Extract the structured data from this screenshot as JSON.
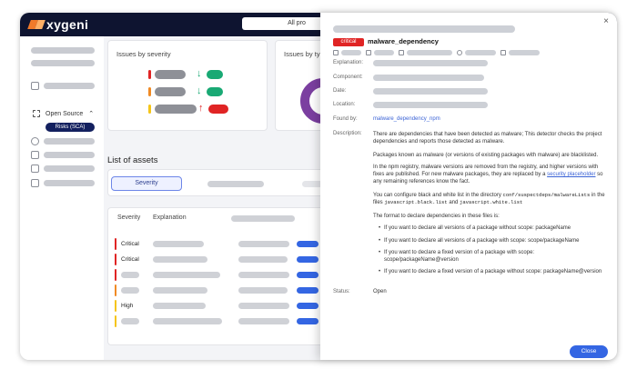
{
  "topbar": {
    "logo_text": "xygeni",
    "project_selector": "All pro"
  },
  "sidebar": {
    "open_source_label": "Open Source",
    "risks_label": "Risks (SCA)"
  },
  "cards": {
    "issues_by_severity": "Issues by severity",
    "issues_by_type": "Issues by typ"
  },
  "assets": {
    "title": "List of assets",
    "severity_button": "Severity"
  },
  "table": {
    "columns": [
      "Severity",
      "Explanation"
    ],
    "rows": [
      "Critical",
      "Critical",
      "",
      "",
      "High",
      ""
    ]
  },
  "modal": {
    "badge": "critical",
    "title": "malware_dependency",
    "fields": {
      "explanation": "Explanation:",
      "component": "Component:",
      "date": "Date:",
      "location": "Location:",
      "found_by": "Found by:",
      "description": "Description:",
      "status": "Status:"
    },
    "found_by_value": "malware_dependency_npm",
    "desc_p1": "There are dependencies that have been detected as malware; This detector checks the project dependencies and reports those detected as malware.",
    "desc_p2": "Packages known as malware (or versions of existing packages with malware) are blacklisted.",
    "desc_p3_a": "In the npm registry, malware versions are removed from the registry, and higher versions with fixes are published. For new malware packages, they are replaced by a ",
    "desc_p3_link": "security placeholder",
    "desc_p3_b": " so any remaining references know the fact.",
    "desc_p4_a": "You can configure black and white list in the directory ",
    "desc_p4_code1": "conf/suspectdeps/malwareLists",
    "desc_p4_b": " in the files ",
    "desc_p4_code2": "javascript.black.list",
    "desc_p4_c": " and ",
    "desc_p4_code3": "javascript.white.list",
    "desc_p5": "The format to declare dependencies in these files is:",
    "bullets": [
      "If you want to declare all versions of a package without scope: packageName",
      "If you want to declare all versions of a package with scope: scope/packageName",
      "If you want to declare a fixed version of a package with scope: scope/packageName@version",
      "If you want to declare a fixed version of a package without scope: packageName@version"
    ],
    "status_value": "Open",
    "close_label": "Close",
    "close_icon": "×"
  },
  "colors": {
    "critical": "#e02424",
    "high": "#f5c518",
    "medium": "#f08a24",
    "ok": "#19a974",
    "accent": "#3466e3",
    "nav": "#0e1430"
  }
}
